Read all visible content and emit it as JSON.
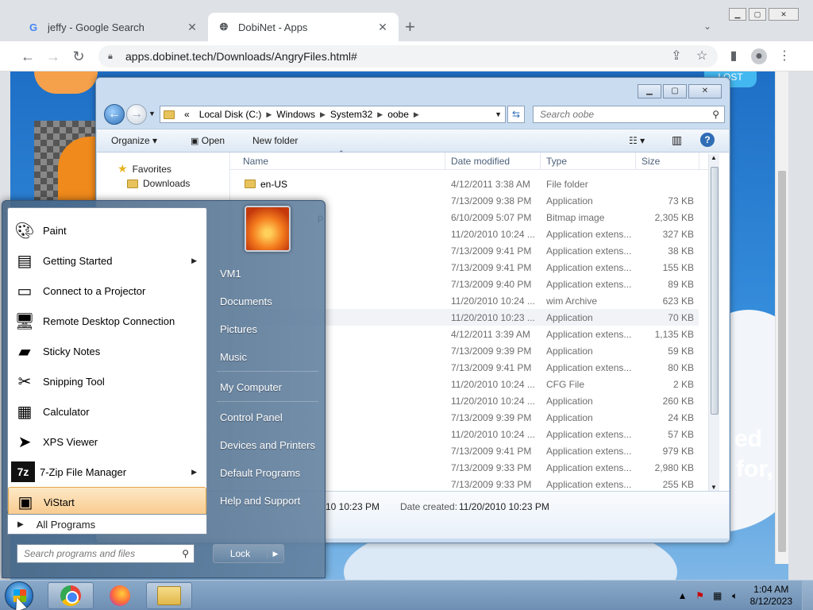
{
  "browser": {
    "tabs": [
      {
        "title": "jeffy - Google Search",
        "favicon": "G",
        "active": false
      },
      {
        "title": "DobiNet - Apps",
        "favicon": "globe-icon",
        "active": true
      }
    ],
    "url": "apps.dobinet.tech/Downloads/AngryFiles.html#",
    "new_tab": "+",
    "back": "←",
    "forward": "→",
    "reload": "↻"
  },
  "page": {
    "badge": "LOST",
    "overlay_text_1": "ed",
    "overlay_text_2": "for,"
  },
  "explorer": {
    "breadcrumb": [
      "«",
      "Local Disk (C:)",
      "Windows",
      "System32",
      "oobe"
    ],
    "search_placeholder": "Search oobe",
    "commands": {
      "organize": "Organize",
      "open": "Open",
      "new_folder": "New folder"
    },
    "nav": {
      "favorites": "Favorites",
      "downloads": "Downloads"
    },
    "columns": {
      "name": "Name",
      "date": "Date modified",
      "type": "Type",
      "size": "Size"
    },
    "rows": [
      {
        "name": "en-US",
        "date": "4/12/2011 3:38 AM",
        "type": "File folder",
        "size": ""
      },
      {
        "name": "",
        "date": "7/13/2009 9:38 PM",
        "type": "Application",
        "size": "73 KB"
      },
      {
        "name": "p",
        "date": "6/10/2009 5:07 PM",
        "type": "Bitmap image",
        "size": "2,305 KB"
      },
      {
        "name": "",
        "date": "11/20/2010 10:24 ...",
        "type": "Application extens...",
        "size": "327 KB"
      },
      {
        "name": "",
        "date": "7/13/2009 9:41 PM",
        "type": "Application extens...",
        "size": "38 KB"
      },
      {
        "name": "",
        "date": "7/13/2009 9:41 PM",
        "type": "Application extens...",
        "size": "155 KB"
      },
      {
        "name": "",
        "date": "7/13/2009 9:40 PM",
        "type": "Application extens...",
        "size": "89 KB"
      },
      {
        "name": "",
        "date": "11/20/2010 10:24 ...",
        "type": "wim Archive",
        "size": "623 KB"
      },
      {
        "name": "",
        "date": "11/20/2010 10:23 ...",
        "type": "Application",
        "size": "70 KB"
      },
      {
        "name": "",
        "date": "4/12/2011 3:39 AM",
        "type": "Application extens...",
        "size": "1,135 KB"
      },
      {
        "name": "",
        "date": "7/13/2009 9:39 PM",
        "type": "Application",
        "size": "59 KB"
      },
      {
        "name": "",
        "date": "7/13/2009 9:41 PM",
        "type": "Application extens...",
        "size": "80 KB"
      },
      {
        "name": "",
        "date": "11/20/2010 10:24 ...",
        "type": "CFG File",
        "size": "2 KB"
      },
      {
        "name": "",
        "date": "11/20/2010 10:24 ...",
        "type": "Application",
        "size": "260 KB"
      },
      {
        "name": "",
        "date": "7/13/2009 9:39 PM",
        "type": "Application",
        "size": "24 KB"
      },
      {
        "name": "",
        "date": "11/20/2010 10:24 ...",
        "type": "Application extens...",
        "size": "57 KB"
      },
      {
        "name": "",
        "date": "7/13/2009 9:41 PM",
        "type": "Application extens...",
        "size": "979 KB"
      },
      {
        "name": "",
        "date": "7/13/2009 9:33 PM",
        "type": "Application extens...",
        "size": "2,980 KB"
      },
      {
        "name": "",
        "date": "7/13/2009 9:33 PM",
        "type": "Application extens...",
        "size": "255 KB"
      }
    ],
    "details": {
      "modified_partial": "10 10:23 PM",
      "created_label": "Date created:",
      "created_value": "11/20/2010 10:23 PM"
    }
  },
  "startmenu": {
    "programs": [
      {
        "label": "Paint",
        "icon": "paint-icon",
        "submenu": false
      },
      {
        "label": "Getting Started",
        "icon": "getting-started-icon",
        "submenu": true
      },
      {
        "label": "Connect to a Projector",
        "icon": "projector-icon",
        "submenu": false
      },
      {
        "label": "Remote Desktop Connection",
        "icon": "remote-desktop-icon",
        "submenu": false
      },
      {
        "label": "Sticky Notes",
        "icon": "sticky-notes-icon",
        "submenu": false
      },
      {
        "label": "Snipping Tool",
        "icon": "scissors-icon",
        "submenu": false
      },
      {
        "label": "Calculator",
        "icon": "calculator-icon",
        "submenu": false
      },
      {
        "label": "XPS Viewer",
        "icon": "xps-icon",
        "submenu": false
      },
      {
        "label": "7-Zip File Manager",
        "icon": "7zip-icon",
        "submenu": true
      },
      {
        "label": "ViStart",
        "icon": "vistart-icon",
        "submenu": false,
        "selected": true
      }
    ],
    "all_programs": "All Programs",
    "search_placeholder": "Search programs and files",
    "right": [
      "VM1",
      "Documents",
      "Pictures",
      "Music",
      "My Computer",
      "Control Panel",
      "Devices and Printers",
      "Default Programs",
      "Help and Support"
    ],
    "lock": "Lock"
  },
  "taskbar": {
    "time": "1:04 AM",
    "date": "8/12/2023"
  }
}
